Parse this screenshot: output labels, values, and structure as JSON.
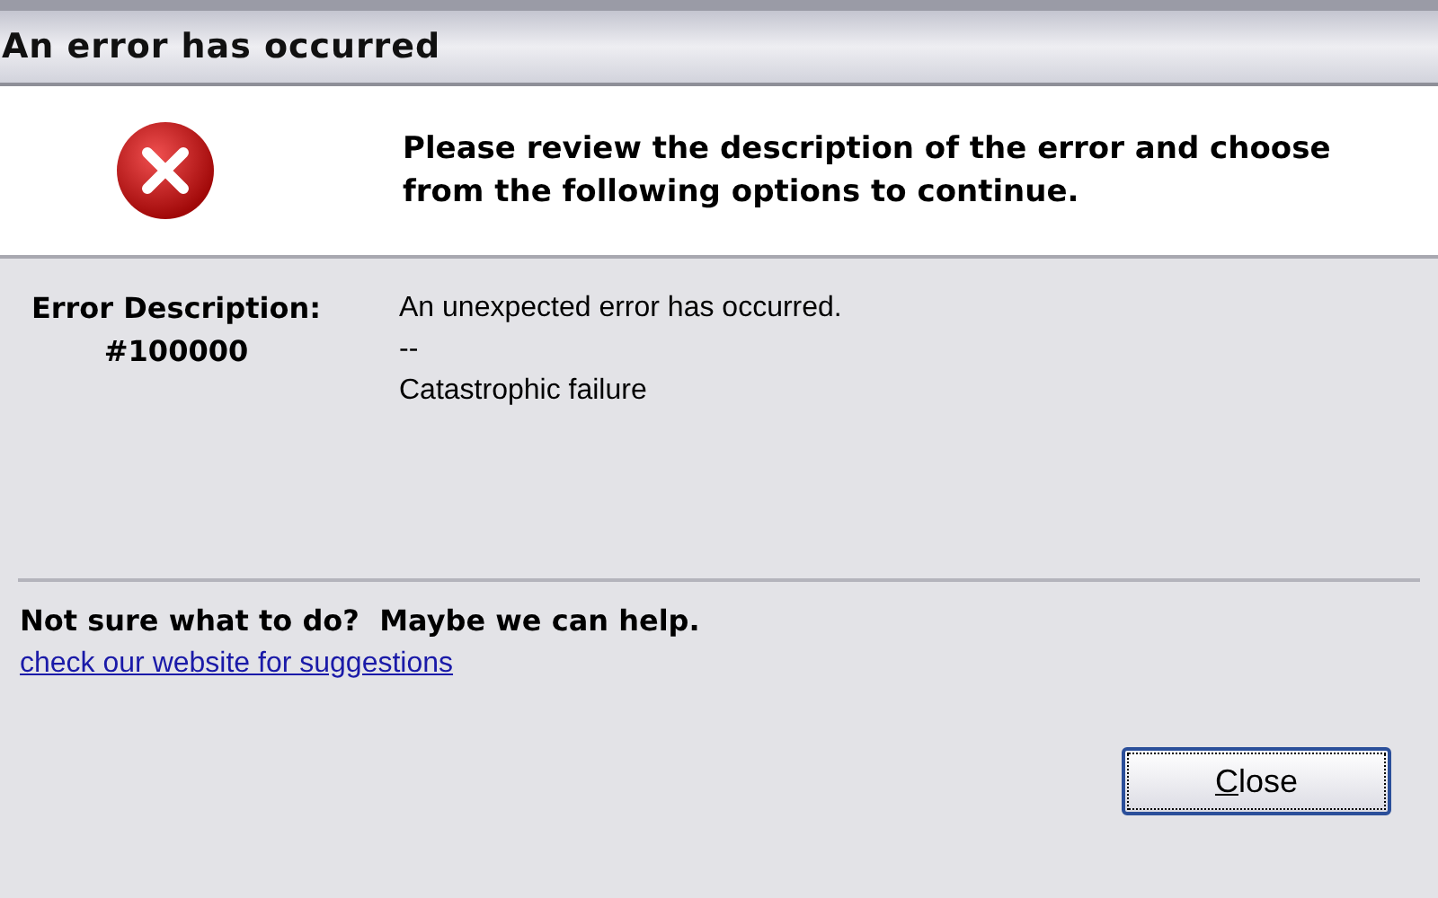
{
  "window": {
    "title": "An error has occurred"
  },
  "header": {
    "message": "Please review the description of the error and choose from the following options to continue."
  },
  "error": {
    "label": "Error Description:",
    "code": "#100000",
    "lines": [
      "An unexpected error has occurred.",
      "--",
      "Catastrophic failure"
    ]
  },
  "help": {
    "heading": "Not sure what to do?  Maybe we can help.",
    "link": "check our website for suggestions"
  },
  "buttons": [
    {
      "label": "Close",
      "focused": true
    }
  ]
}
